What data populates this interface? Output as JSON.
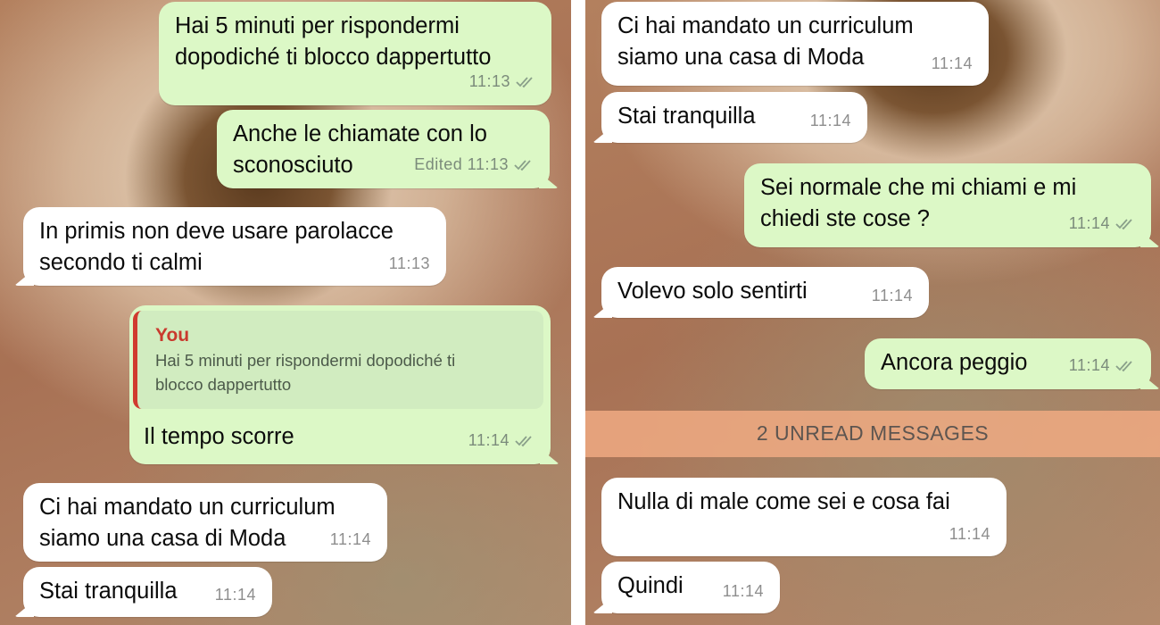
{
  "left": {
    "messages": [
      {
        "text": "Hai 5 minuti per rispondermi\ndopodiché ti blocco dappertutto",
        "time": "11:13"
      },
      {
        "text": "Anche le chiamate con lo\nsconosciuto",
        "time": "11:13",
        "edited": "Edited"
      },
      {
        "text": "In primis non deve usare parolacce\nsecondo ti calmi",
        "time": "11:13"
      },
      {
        "quote_author": "You",
        "quote_text": "Hai 5 minuti per rispondermi dopodiché ti\nblocco dappertutto",
        "text": "Il tempo scorre",
        "time": "11:14"
      },
      {
        "text": "Ci hai mandato un curriculum\nsiamo una casa di Moda",
        "time": "11:14"
      },
      {
        "text": "Stai tranquilla",
        "time": "11:14"
      }
    ]
  },
  "right": {
    "messages": [
      {
        "text": "Ci hai mandato un curriculum\nsiamo una casa di Moda",
        "time": "11:14"
      },
      {
        "text": "Stai tranquilla",
        "time": "11:14"
      },
      {
        "text": "Sei normale che mi chiami e mi\nchiedi ste cose ?",
        "time": "11:14"
      },
      {
        "text": "Volevo solo sentirti",
        "time": "11:14"
      },
      {
        "text": "Ancora peggio",
        "time": "11:14"
      },
      {
        "text": "Nulla di male come sei e cosa fai",
        "time": "11:14"
      },
      {
        "text": "Quindi",
        "time": "11:14"
      }
    ],
    "unread_banner": "2 UNREAD MESSAGES"
  },
  "colors": {
    "outgoing": "#dcf8c6",
    "incoming": "#ffffff",
    "quote_accent": "#d03b2f",
    "unread_bar": "#f0aa82"
  },
  "icons": {
    "read_receipt": "double-check-icon"
  }
}
